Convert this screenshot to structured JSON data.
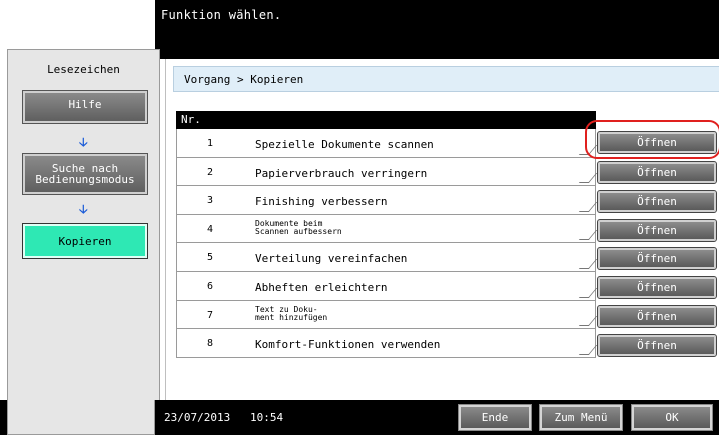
{
  "header": {
    "message": "Funktion wählen."
  },
  "sidebar": {
    "title": "Lesezeichen",
    "help_label": "Hilfe",
    "mode_search_line1": "Suche nach",
    "mode_search_line2": "Bedienungsmodus",
    "copy_label": "Kopieren"
  },
  "breadcrumb": "Vorgang > Kopieren",
  "table": {
    "header": "Nr.",
    "rows": [
      {
        "num": "1",
        "label": "Spezielle Dokumente scannen",
        "label2": "",
        "action": "Öffnen"
      },
      {
        "num": "2",
        "label": "Papierverbrauch verringern",
        "label2": "",
        "action": "Öffnen"
      },
      {
        "num": "3",
        "label": "Finishing verbessern",
        "label2": "",
        "action": "Öffnen"
      },
      {
        "num": "4",
        "label": "Dokumente beim",
        "label2": "Scannen aufbessern",
        "action": "Öffnen"
      },
      {
        "num": "5",
        "label": "Verteilung vereinfachen",
        "label2": "",
        "action": "Öffnen"
      },
      {
        "num": "6",
        "label": "Abheften erleichtern",
        "label2": "",
        "action": "Öffnen"
      },
      {
        "num": "7",
        "label": "Text zu Doku-",
        "label2": "ment hinzufügen",
        "action": "Öffnen"
      },
      {
        "num": "8",
        "label": "Komfort-Funktionen verwenden",
        "label2": "",
        "action": "Öffnen"
      }
    ]
  },
  "footer": {
    "date": "23/07/2013",
    "time": "10:54",
    "end_label": "Ende",
    "menu_label": "Zum Menü",
    "ok_label": "OK"
  },
  "colors": {
    "highlight": "#e0201e",
    "copy_button": "#2ee8b4",
    "arrow": "#1b5cd8"
  }
}
